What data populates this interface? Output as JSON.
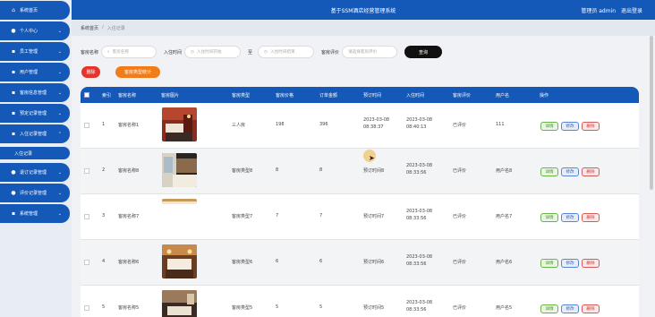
{
  "app": {
    "title": "基于SSM酒店经营管理系统",
    "user_text": "管理员 admin",
    "logout": "退出登录"
  },
  "sidebar": {
    "items": [
      {
        "label": "系统首页",
        "icon": "home-icon"
      },
      {
        "label": "个人中心",
        "icon": "user-icon"
      },
      {
        "label": "员工管理",
        "icon": "grid-icon"
      },
      {
        "label": "用户管理",
        "icon": "grid-icon"
      },
      {
        "label": "客房信息管理",
        "icon": "grid-icon"
      },
      {
        "label": "预定记录管理",
        "icon": "grid-icon"
      },
      {
        "label": "入住记录管理",
        "icon": "grid-icon"
      },
      {
        "label": "退订记录管理",
        "icon": "grid-icon"
      },
      {
        "label": "评价记录管理",
        "icon": "grid-icon"
      },
      {
        "label": "系统管理",
        "icon": "grid-icon"
      }
    ],
    "active_sub": "入住记录"
  },
  "breadcrumb": {
    "home": "系统首页",
    "current": "入住记录"
  },
  "search": {
    "room_name_label": "客房名称",
    "room_name_placeholder": "客房名称",
    "checkin_label": "入住时间",
    "start_placeholder": "入住时间开始",
    "to": "至",
    "end_placeholder": "入住时间结束",
    "review_label": "客房评价",
    "review_placeholder": "请选择客房评价",
    "query_button": "查询"
  },
  "actions": {
    "delete": "删除",
    "room_stats": "客房类型统计"
  },
  "table": {
    "headers": [
      "索引",
      "客房名称",
      "客房图片",
      "客房类型",
      "客房价格",
      "订单金额",
      "预订时间",
      "入住时间",
      "客房评价",
      "用户名",
      "操作"
    ],
    "rows": [
      {
        "index": "1",
        "name": "客房名称1",
        "type": "三人房",
        "price": "198",
        "amount": "396",
        "book_time": "2023-03-08 08:38:37",
        "checkin_time": "2023-03-08 08:40:13",
        "review": "已评价",
        "username": "111"
      },
      {
        "index": "2",
        "name": "客房名称8",
        "type": "客房类型8",
        "price": "8",
        "amount": "8",
        "book_time": "预订时间8",
        "checkin_time": "2023-03-08 08:33:56",
        "review": "已评价",
        "username": "用户名8"
      },
      {
        "index": "3",
        "name": "客房名称7",
        "type": "客房类型7",
        "price": "7",
        "amount": "7",
        "book_time": "预订时间7",
        "checkin_time": "2023-03-08 08:33:56",
        "review": "已评价",
        "username": "用户名7"
      },
      {
        "index": "4",
        "name": "客房名称6",
        "type": "客房类型6",
        "price": "6",
        "amount": "6",
        "book_time": "预订时间6",
        "checkin_time": "2023-03-08 08:33:56",
        "review": "已评价",
        "username": "用户名6"
      },
      {
        "index": "5",
        "name": "客房名称5",
        "type": "客房类型5",
        "price": "5",
        "amount": "5",
        "book_time": "预订时间5",
        "checkin_time": "2023-03-08 08:33:56",
        "review": "已评价",
        "username": "用户名5"
      }
    ],
    "btn_detail": "详情",
    "btn_edit": "修改",
    "btn_delete": "删除"
  },
  "colors": {
    "primary": "#1458b8",
    "danger": "#e6342a",
    "warning": "#f07d1a"
  }
}
